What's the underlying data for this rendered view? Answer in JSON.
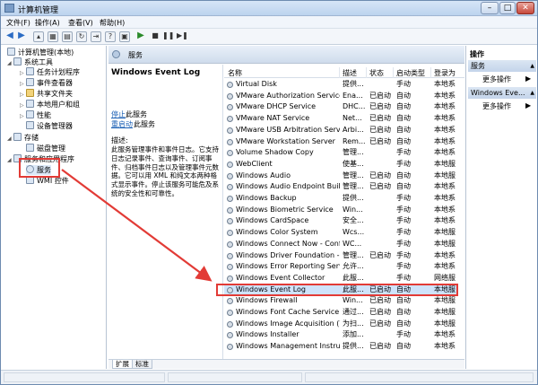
{
  "window": {
    "title": "计算机管理"
  },
  "menu": [
    "文件(F)",
    "操作(A)",
    "查看(V)",
    "帮助(H)"
  ],
  "tree": {
    "root": "计算机管理(本地)",
    "system_tools": "系统工具",
    "items": [
      "任务计划程序",
      "事件查看器",
      "共享文件夹",
      "本地用户和组",
      "性能",
      "设备管理器"
    ],
    "storage": "存储",
    "disk": "磁盘管理",
    "services_apps": "服务和应用程序",
    "services": "服务",
    "wmi": "WMI 控件"
  },
  "center": {
    "header": "服务",
    "selected_service": "Windows Event Log",
    "stop_link": "停止",
    "restart_link": "重启动",
    "link_suffix": "此服务",
    "desc_label": "描述:",
    "desc_text": "此服务管理事件和事件日志。它支持日志记录事件、查询事件、订阅事件、归档事件日志以及管理事件元数据。它可以用 XML 和纯文本两种格式显示事件。停止该服务可能危及系统的安全性和可靠性。"
  },
  "columns": {
    "name": "名称",
    "desc": "描述",
    "status": "状态",
    "startup": "启动类型",
    "logon": "登录为"
  },
  "services": [
    {
      "name": "Virtual Disk",
      "desc": "提供...",
      "status": "",
      "startup": "手动",
      "logon": "本地系"
    },
    {
      "name": "VMware Authorization Service",
      "desc": "Ena...",
      "status": "已启动",
      "startup": "自动",
      "logon": "本地系"
    },
    {
      "name": "VMware DHCP Service",
      "desc": "DHC...",
      "status": "已启动",
      "startup": "自动",
      "logon": "本地系"
    },
    {
      "name": "VMware NAT Service",
      "desc": "Net...",
      "status": "已启动",
      "startup": "自动",
      "logon": "本地系"
    },
    {
      "name": "VMware USB Arbitration Service",
      "desc": "Arbi...",
      "status": "已启动",
      "startup": "自动",
      "logon": "本地系"
    },
    {
      "name": "VMware Workstation Server",
      "desc": "Rem...",
      "status": "已启动",
      "startup": "自动",
      "logon": "本地系"
    },
    {
      "name": "Volume Shadow Copy",
      "desc": "管理...",
      "status": "",
      "startup": "手动",
      "logon": "本地系"
    },
    {
      "name": "WebClient",
      "desc": "使基...",
      "status": "",
      "startup": "手动",
      "logon": "本地服"
    },
    {
      "name": "Windows Audio",
      "desc": "管理...",
      "status": "已启动",
      "startup": "自动",
      "logon": "本地服"
    },
    {
      "name": "Windows Audio Endpoint Builder",
      "desc": "管理...",
      "status": "已启动",
      "startup": "自动",
      "logon": "本地系"
    },
    {
      "name": "Windows Backup",
      "desc": "提供...",
      "status": "",
      "startup": "手动",
      "logon": "本地系"
    },
    {
      "name": "Windows Biometric Service",
      "desc": "Win...",
      "status": "",
      "startup": "手动",
      "logon": "本地系"
    },
    {
      "name": "Windows CardSpace",
      "desc": "安全...",
      "status": "",
      "startup": "手动",
      "logon": "本地系"
    },
    {
      "name": "Windows Color System",
      "desc": "Wcs...",
      "status": "",
      "startup": "手动",
      "logon": "本地服"
    },
    {
      "name": "Windows Connect Now - Confi...",
      "desc": "WC...",
      "status": "",
      "startup": "手动",
      "logon": "本地服"
    },
    {
      "name": "Windows Driver Foundation - U...",
      "desc": "管理...",
      "status": "已启动",
      "startup": "手动",
      "logon": "本地系"
    },
    {
      "name": "Windows Error Reporting Servi...",
      "desc": "允许...",
      "status": "",
      "startup": "手动",
      "logon": "本地系"
    },
    {
      "name": "Windows Event Collector",
      "desc": "此服...",
      "status": "",
      "startup": "手动",
      "logon": "网络服"
    },
    {
      "name": "Windows Event Log",
      "desc": "此服...",
      "status": "已启动",
      "startup": "自动",
      "logon": "本地服"
    },
    {
      "name": "Windows Firewall",
      "desc": "Win...",
      "status": "已启动",
      "startup": "自动",
      "logon": "本地服"
    },
    {
      "name": "Windows Font Cache Service",
      "desc": "通过...",
      "status": "已启动",
      "startup": "自动",
      "logon": "本地服"
    },
    {
      "name": "Windows Image Acquisition (W...",
      "desc": "为扫...",
      "status": "已启动",
      "startup": "自动",
      "logon": "本地服"
    },
    {
      "name": "Windows Installer",
      "desc": "添加...",
      "status": "",
      "startup": "手动",
      "logon": "本地系"
    },
    {
      "name": "Windows Management Instrum...",
      "desc": "提供...",
      "status": "已启动",
      "startup": "自动",
      "logon": "本地系"
    }
  ],
  "tabs": [
    "扩展",
    "标准"
  ],
  "actions": {
    "title": "操作",
    "group1": "服务",
    "more1": "更多操作",
    "group2": "Windows Eve...",
    "more2": "更多操作"
  },
  "colors": {
    "highlight": "#e23b36",
    "selected_row": "#cfe3fb"
  }
}
